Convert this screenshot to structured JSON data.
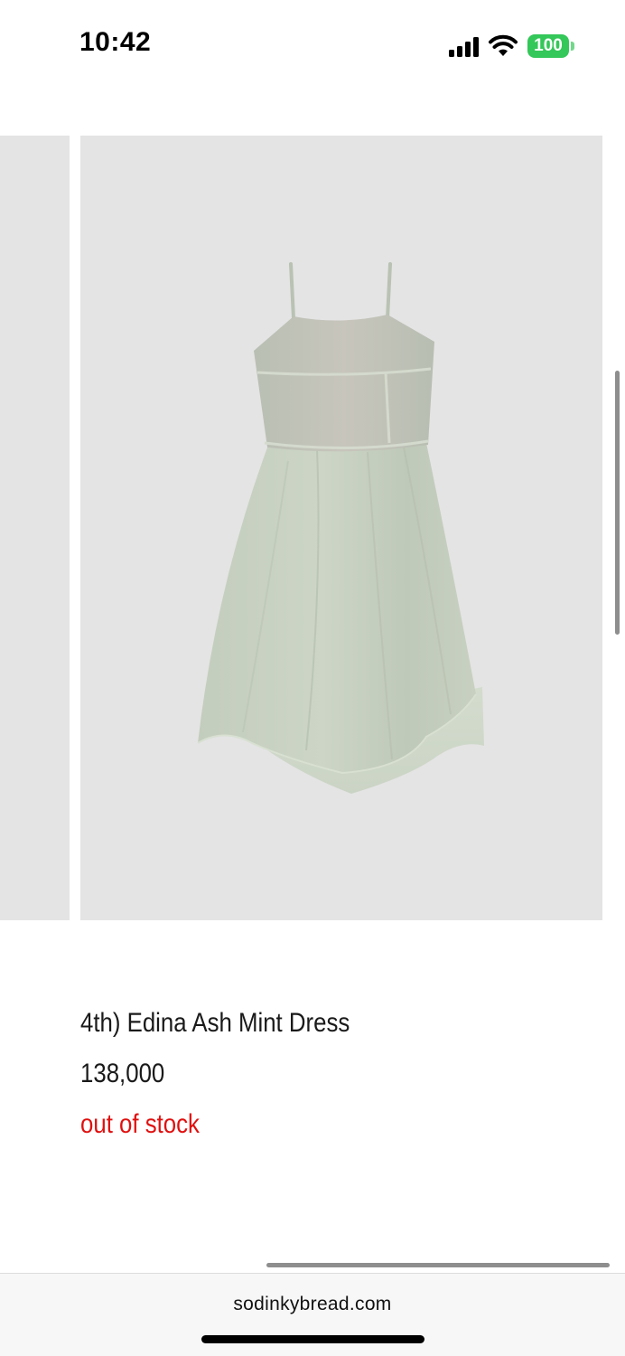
{
  "status_bar": {
    "time": "10:42",
    "battery_level": "100",
    "icons": [
      "signal-icon",
      "wifi-icon",
      "battery-icon"
    ],
    "battery_color": "#34c759"
  },
  "carousel": {
    "background_color": "#e4e4e4",
    "current_image": "dress-photo",
    "dress_color": "#c9d2c2"
  },
  "product": {
    "title": "4th) Edina Ash Mint Dress",
    "price": "138,000",
    "stock_status": "out of stock",
    "stock_status_color": "#e0100f"
  },
  "browser": {
    "url": "sodinkybread.com"
  }
}
